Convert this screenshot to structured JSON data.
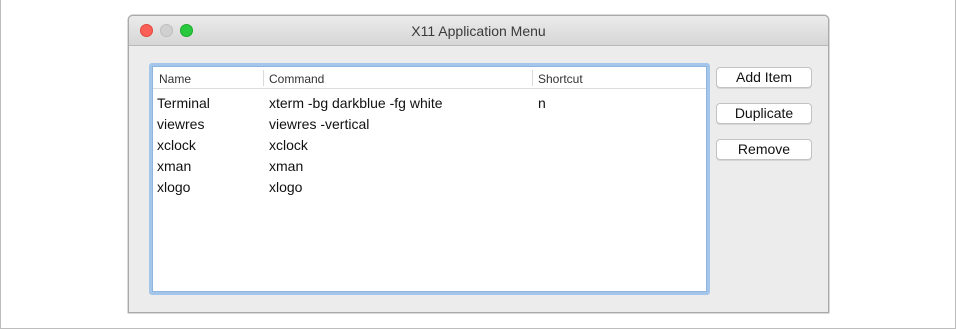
{
  "window": {
    "title": "X11 Application Menu"
  },
  "list": {
    "columns": [
      "Name",
      "Command",
      "Shortcut"
    ],
    "rows": [
      {
        "name": "Terminal",
        "command": "xterm -bg darkblue -fg white",
        "shortcut": "n"
      },
      {
        "name": "viewres",
        "command": "viewres -vertical",
        "shortcut": ""
      },
      {
        "name": "xclock",
        "command": "xclock",
        "shortcut": ""
      },
      {
        "name": "xman",
        "command": "xman",
        "shortcut": ""
      },
      {
        "name": "xlogo",
        "command": "xlogo",
        "shortcut": ""
      }
    ]
  },
  "buttons": {
    "add_item": "Add Item",
    "duplicate": "Duplicate",
    "remove": "Remove"
  },
  "colors": {
    "close": "#fc5f57",
    "minimize_inactive": "#d0d0d0",
    "maximize": "#28c83f",
    "focus_ring": "#a4c6ea"
  }
}
